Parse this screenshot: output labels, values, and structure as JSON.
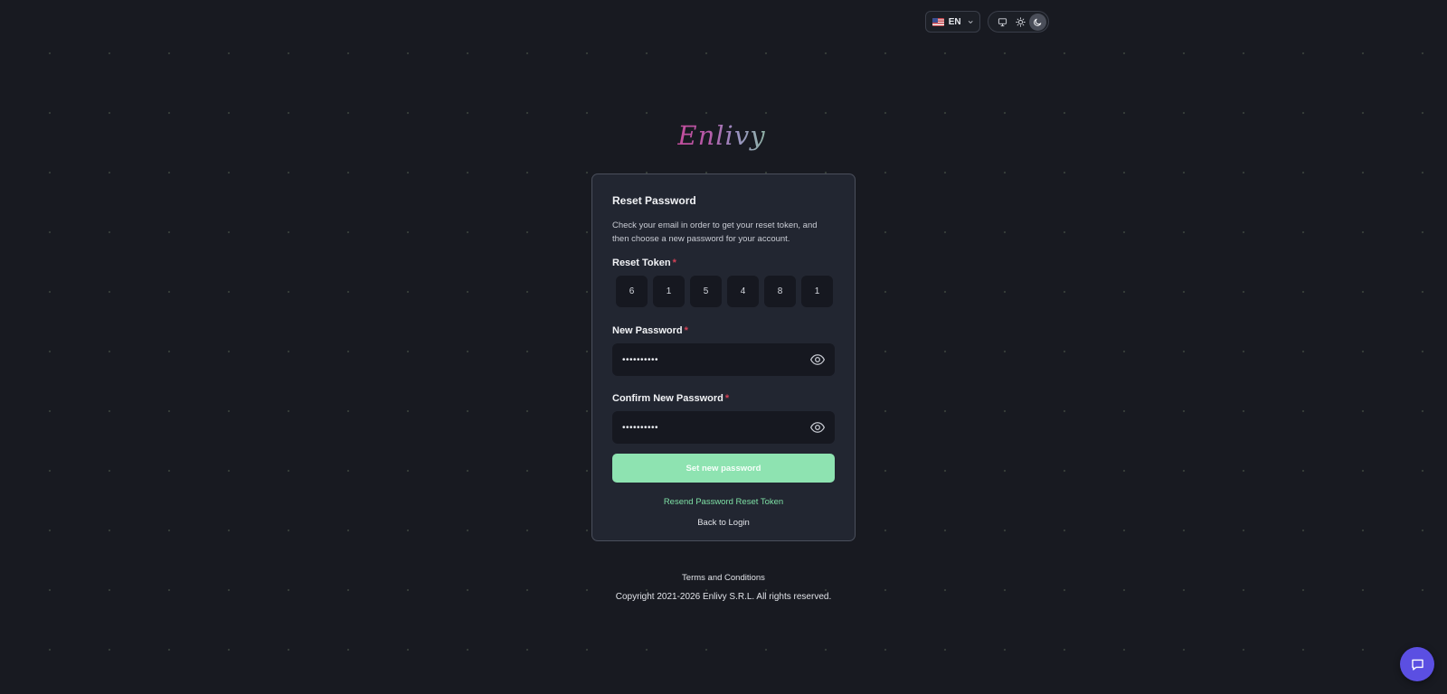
{
  "header": {
    "language": {
      "code": "EN",
      "flag_icon": "us-flag-icon"
    },
    "theme": {
      "options": [
        "system",
        "light",
        "dark"
      ],
      "active": "dark"
    }
  },
  "logo": {
    "text": "Enlivy"
  },
  "form": {
    "title": "Reset Password",
    "description": "Check your email in order to get your reset token, and then choose a new password for your account.",
    "reset_token": {
      "label": "Reset Token",
      "required_mark": "*",
      "digits": [
        "6",
        "1",
        "5",
        "4",
        "8",
        "1"
      ]
    },
    "new_password": {
      "label": "New Password",
      "required_mark": "*",
      "value_masked": "••••••••••"
    },
    "confirm_password": {
      "label": "Confirm New Password",
      "required_mark": "*",
      "value_masked": "••••••••••"
    },
    "submit_label": "Set new password",
    "resend_link": "Resend Password Reset Token",
    "back_link": "Back to Login"
  },
  "footer": {
    "terms": "Terms and Conditions",
    "copyright": "Copyright 2021-2026 Enlivy S.R.L. All rights reserved."
  },
  "colors": {
    "background": "#181a21",
    "card": "#222631",
    "accent_green": "#8ee3b1",
    "link_green": "#7ee0a5",
    "required_red": "#d44256",
    "chat_purple": "#5b4fe2"
  }
}
